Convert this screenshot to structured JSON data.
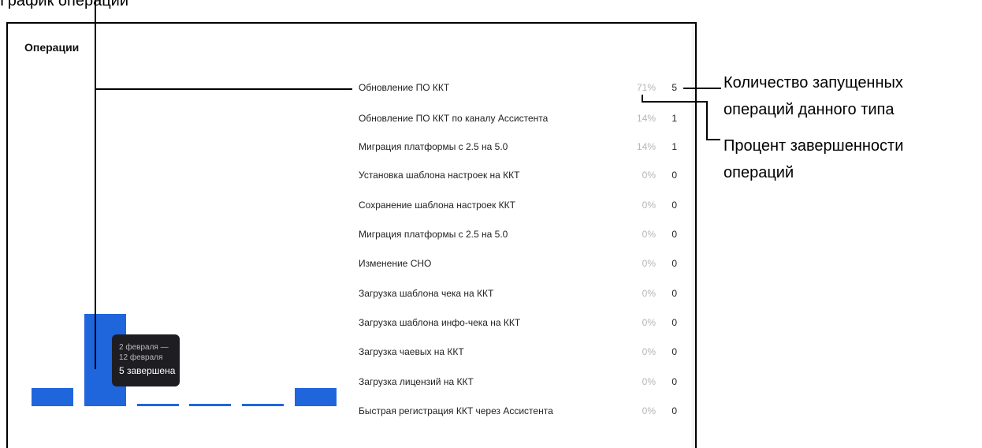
{
  "top_caption": "График операций",
  "panel": {
    "title": "Операции"
  },
  "chart": {
    "bar_color": "#1f66dd",
    "bars": [
      1,
      5,
      0.1,
      0.1,
      0.1,
      1
    ],
    "tooltip": {
      "line1": "2 февраля —",
      "line2": "12 февраля",
      "line3": "5 завершена"
    }
  },
  "operations": [
    {
      "label": "Обновление ПО ККТ",
      "pct": "71%",
      "count": "5"
    },
    {
      "label": "Обновление ПО ККТ по каналу Ассистента",
      "pct": "14%",
      "count": "1"
    },
    {
      "label": "Миграция платформы с 2.5 на 5.0",
      "pct": "14%",
      "count": "1"
    },
    {
      "label": "Установка шаблона настроек на ККТ",
      "pct": "0%",
      "count": "0"
    },
    {
      "label": "Сохранение шаблона настроек ККТ",
      "pct": "0%",
      "count": "0"
    },
    {
      "label": "Миграция платформы с 2.5 на 5.0",
      "pct": "0%",
      "count": "0"
    },
    {
      "label": "Изменение СНО",
      "pct": "0%",
      "count": "0"
    },
    {
      "label": "Загрузка шаблона чека на ККТ",
      "pct": "0%",
      "count": "0"
    },
    {
      "label": "Загрузка шаблона инфо-чека на ККТ",
      "pct": "0%",
      "count": "0"
    },
    {
      "label": "Загрузка чаевых на ККТ",
      "pct": "0%",
      "count": "0"
    },
    {
      "label": "Загрузка лицензий на ККТ",
      "pct": "0%",
      "count": "0"
    },
    {
      "label": "Быстрая регистрация ККТ через Ассистента",
      "pct": "0%",
      "count": "0"
    }
  ],
  "annotations": {
    "count": "Количество запущенных операций данного типа",
    "count_line1": "Количество запущенных",
    "count_line2": "операций данного типа",
    "percent_line1": "Процент завершенности",
    "percent_line2": "операций"
  }
}
